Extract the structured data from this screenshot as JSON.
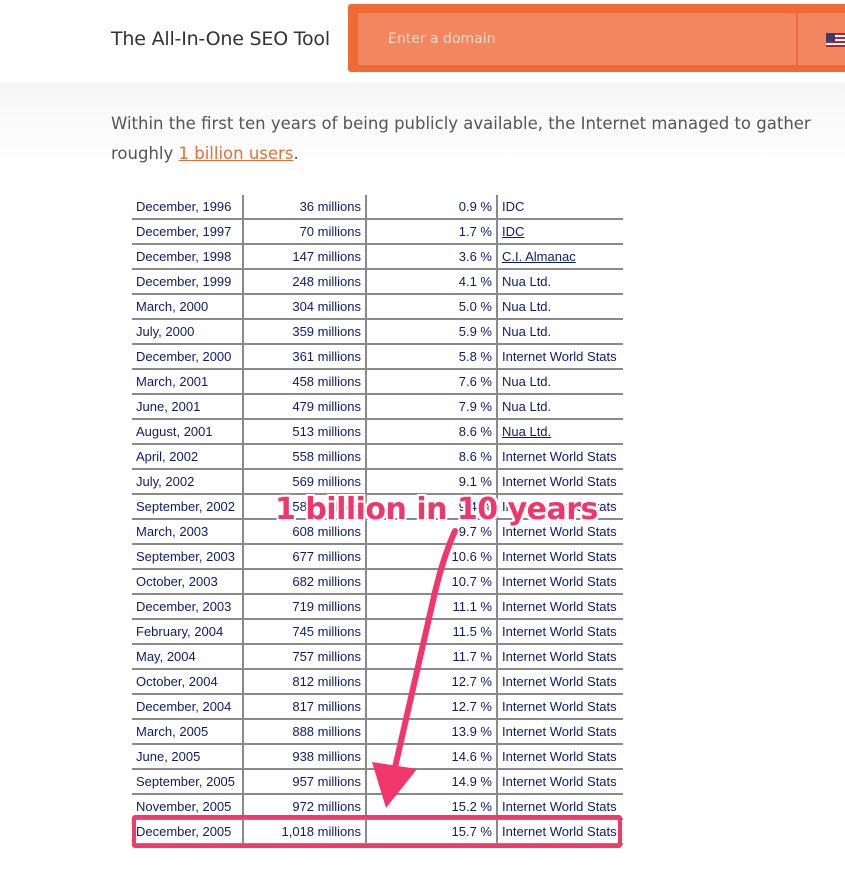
{
  "header": {
    "brand": "The All-In-One SEO Tool",
    "search_placeholder": "Enter a domain"
  },
  "intro": {
    "text_before": "Within the first ten years of being publicly available, the Internet managed to gather roughly ",
    "link_text": "1 billion users",
    "text_after": "."
  },
  "annotation": {
    "text": "1 billion in 10 years",
    "color": "#f0366a"
  },
  "table": {
    "rows": [
      {
        "date": "December, 1996",
        "users": "36 millions",
        "pct": "0.9 %",
        "source": "IDC",
        "link": false
      },
      {
        "date": "December, 1997",
        "users": "70 millions",
        "pct": "1.7 %",
        "source": "IDC",
        "link": true
      },
      {
        "date": "December, 1998",
        "users": "147 millions",
        "pct": "3.6 %",
        "source": "C.I. Almanac",
        "link": true
      },
      {
        "date": "December, 1999",
        "users": "248 millions",
        "pct": "4.1 %",
        "source": "Nua Ltd.",
        "link": false
      },
      {
        "date": "March, 2000",
        "users": "304 millions",
        "pct": "5.0 %",
        "source": "Nua Ltd.",
        "link": false
      },
      {
        "date": "July, 2000",
        "users": "359 millions",
        "pct": "5.9 %",
        "source": "Nua Ltd.",
        "link": false
      },
      {
        "date": "December, 2000",
        "users": "361 millions",
        "pct": "5.8 %",
        "source": "Internet World Stats",
        "link": false
      },
      {
        "date": "March, 2001",
        "users": "458 millions",
        "pct": "7.6 %",
        "source": "Nua Ltd.",
        "link": false
      },
      {
        "date": "June, 2001",
        "users": "479 millions",
        "pct": "7.9 %",
        "source": "Nua Ltd.",
        "link": false
      },
      {
        "date": "August, 2001",
        "users": "513 millions",
        "pct": "8.6 %",
        "source": "Nua Ltd.",
        "link": true
      },
      {
        "date": "April, 2002",
        "users": "558 millions",
        "pct": "8.6 %",
        "source": "Internet World Stats",
        "link": false
      },
      {
        "date": "July, 2002",
        "users": "569 millions",
        "pct": "9.1 %",
        "source": "Internet World Stats",
        "link": false
      },
      {
        "date": "September, 2002",
        "users": "587 millions",
        "pct": "9.4 %",
        "source": "Internet World Stats",
        "link": false
      },
      {
        "date": "March, 2003",
        "users": "608 millions",
        "pct": "9.7 %",
        "source": "Internet World Stats",
        "link": false
      },
      {
        "date": "September, 2003",
        "users": "677 millions",
        "pct": "10.6 %",
        "source": "Internet World Stats",
        "link": false
      },
      {
        "date": "October, 2003",
        "users": "682 millions",
        "pct": "10.7 %",
        "source": "Internet World Stats",
        "link": false
      },
      {
        "date": "December, 2003",
        "users": "719 millions",
        "pct": "11.1 %",
        "source": "Internet World Stats",
        "link": false
      },
      {
        "date": "February, 2004",
        "users": "745 millions",
        "pct": "11.5 %",
        "source": "Internet World Stats",
        "link": false
      },
      {
        "date": "May, 2004",
        "users": "757 millions",
        "pct": "11.7 %",
        "source": "Internet World Stats",
        "link": false
      },
      {
        "date": "October, 2004",
        "users": "812 millions",
        "pct": "12.7 %",
        "source": "Internet World Stats",
        "link": false
      },
      {
        "date": "December, 2004",
        "users": "817 millions",
        "pct": "12.7 %",
        "source": "Internet World Stats",
        "link": false
      },
      {
        "date": "March, 2005",
        "users": "888 millions",
        "pct": "13.9 %",
        "source": "Internet World Stats",
        "link": false
      },
      {
        "date": "June, 2005",
        "users": "938 millions",
        "pct": "14.6 %",
        "source": "Internet World Stats",
        "link": false
      },
      {
        "date": "September, 2005",
        "users": "957 millions",
        "pct": "14.9 %",
        "source": "Internet World Stats",
        "link": false
      },
      {
        "date": "November, 2005",
        "users": "972 millions",
        "pct": "15.2 %",
        "source": "Internet World Stats",
        "link": false
      },
      {
        "date": "December, 2005",
        "users": "1,018 millions",
        "pct": "15.7 %",
        "source": "Internet World Stats",
        "link": false
      }
    ]
  }
}
